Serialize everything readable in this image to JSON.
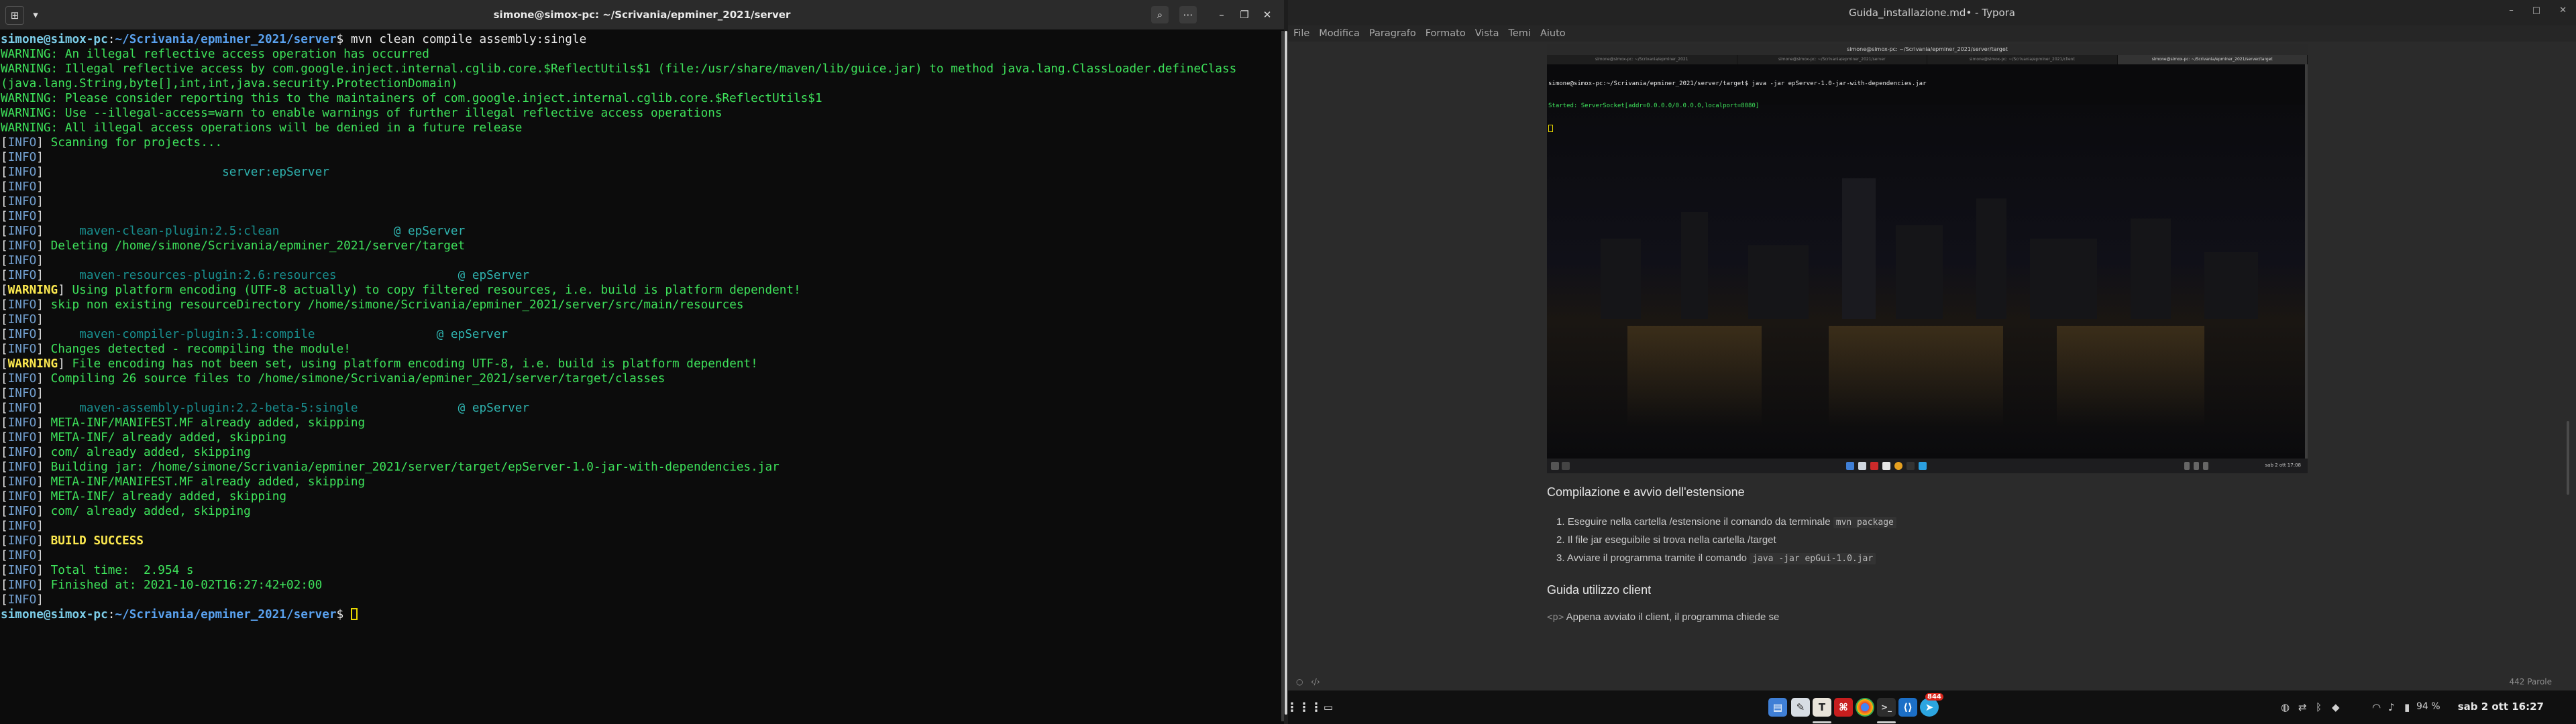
{
  "terminal": {
    "title": "simone@simox-pc: ~/Scrivania/epminer_2021/server",
    "lines": [
      [
        {
          "c": "c-p",
          "t": "simone@simox-pc"
        },
        {
          "c": "c-w",
          "t": ":"
        },
        {
          "c": "c-u",
          "t": "~/Scrivania/epminer_2021/server"
        },
        {
          "c": "c-w",
          "t": "$ mvn clean compile assembly:single"
        }
      ],
      [
        {
          "c": "c-g",
          "t": "WARNING: An illegal reflective access operation has occurred"
        }
      ],
      [
        {
          "c": "c-g",
          "t": "WARNING: Illegal reflective access by com.google.inject.internal.cglib.core.$ReflectUtils$1 (file:/usr/share/maven/lib/guice.jar) to method java.lang.ClassLoader.defineClass"
        }
      ],
      [
        {
          "c": "c-g",
          "t": "(java.lang.String,byte[],int,int,java.security.ProtectionDomain)"
        }
      ],
      [
        {
          "c": "c-g",
          "t": "WARNING: Please consider reporting this to the maintainers of com.google.inject.internal.cglib.core.$ReflectUtils$1"
        }
      ],
      [
        {
          "c": "c-g",
          "t": "WARNING: Use --illegal-access=warn to enable warnings of further illegal reflective access operations"
        }
      ],
      [
        {
          "c": "c-g",
          "t": "WARNING: All illegal access operations will be denied in a future release"
        }
      ],
      [
        {
          "c": "c-w",
          "t": "["
        },
        {
          "c": "c-b",
          "t": "INFO"
        },
        {
          "c": "c-w",
          "t": "] "
        },
        {
          "c": "c-g",
          "t": "Scanning for projects..."
        }
      ],
      [
        {
          "c": "c-w",
          "t": "["
        },
        {
          "c": "c-b",
          "t": "INFO"
        },
        {
          "c": "c-w",
          "t": "]"
        }
      ],
      [
        {
          "c": "c-w",
          "t": "["
        },
        {
          "c": "c-b",
          "t": "INFO"
        },
        {
          "c": "c-w",
          "t": "]                         "
        },
        {
          "c": "c-d",
          "t": "server:epServer"
        }
      ],
      [
        {
          "c": "c-w",
          "t": "["
        },
        {
          "c": "c-b",
          "t": "INFO"
        },
        {
          "c": "c-w",
          "t": "]"
        }
      ],
      [
        {
          "c": "c-w",
          "t": "["
        },
        {
          "c": "c-b",
          "t": "INFO"
        },
        {
          "c": "c-w",
          "t": "]"
        }
      ],
      [
        {
          "c": "c-w",
          "t": "["
        },
        {
          "c": "c-b",
          "t": "INFO"
        },
        {
          "c": "c-w",
          "t": "]"
        }
      ],
      [
        {
          "c": "c-w",
          "t": "["
        },
        {
          "c": "c-b",
          "t": "INFO"
        },
        {
          "c": "c-w",
          "t": "]     "
        },
        {
          "c": "c-t",
          "t": "maven-clean-plugin:2.5:clean"
        },
        {
          "c": "c-w",
          "t": "                "
        },
        {
          "c": "c-d",
          "t": "@ epServer"
        }
      ],
      [
        {
          "c": "c-w",
          "t": "["
        },
        {
          "c": "c-b",
          "t": "INFO"
        },
        {
          "c": "c-w",
          "t": "] "
        },
        {
          "c": "c-g",
          "t": "Deleting /home/simone/Scrivania/epminer_2021/server/target"
        }
      ],
      [
        {
          "c": "c-w",
          "t": "["
        },
        {
          "c": "c-b",
          "t": "INFO"
        },
        {
          "c": "c-w",
          "t": "]"
        }
      ],
      [
        {
          "c": "c-w",
          "t": "["
        },
        {
          "c": "c-b",
          "t": "INFO"
        },
        {
          "c": "c-w",
          "t": "]     "
        },
        {
          "c": "c-t",
          "t": "maven-resources-plugin:2.6:resources"
        },
        {
          "c": "c-w",
          "t": "                 "
        },
        {
          "c": "c-d",
          "t": "@ epServer"
        }
      ],
      [
        {
          "c": "c-w",
          "t": "["
        },
        {
          "c": "c-y",
          "t": "WARNING"
        },
        {
          "c": "c-w",
          "t": "] "
        },
        {
          "c": "c-g",
          "t": "Using platform encoding (UTF-8 actually) to copy filtered resources, i.e. build is platform dependent!"
        }
      ],
      [
        {
          "c": "c-w",
          "t": "["
        },
        {
          "c": "c-b",
          "t": "INFO"
        },
        {
          "c": "c-w",
          "t": "] "
        },
        {
          "c": "c-g",
          "t": "skip non existing resourceDirectory /home/simone/Scrivania/epminer_2021/server/src/main/resources"
        }
      ],
      [
        {
          "c": "c-w",
          "t": "["
        },
        {
          "c": "c-b",
          "t": "INFO"
        },
        {
          "c": "c-w",
          "t": "]"
        }
      ],
      [
        {
          "c": "c-w",
          "t": "["
        },
        {
          "c": "c-b",
          "t": "INFO"
        },
        {
          "c": "c-w",
          "t": "]     "
        },
        {
          "c": "c-t",
          "t": "maven-compiler-plugin:3.1:compile"
        },
        {
          "c": "c-w",
          "t": "                 "
        },
        {
          "c": "c-d",
          "t": "@ epServer"
        }
      ],
      [
        {
          "c": "c-w",
          "t": "["
        },
        {
          "c": "c-b",
          "t": "INFO"
        },
        {
          "c": "c-w",
          "t": "] "
        },
        {
          "c": "c-g",
          "t": "Changes detected - recompiling the module!"
        }
      ],
      [
        {
          "c": "c-w",
          "t": "["
        },
        {
          "c": "c-y",
          "t": "WARNING"
        },
        {
          "c": "c-w",
          "t": "] "
        },
        {
          "c": "c-g",
          "t": "File encoding has not been set, using platform encoding UTF-8, i.e. build is platform dependent!"
        }
      ],
      [
        {
          "c": "c-w",
          "t": "["
        },
        {
          "c": "c-b",
          "t": "INFO"
        },
        {
          "c": "c-w",
          "t": "] "
        },
        {
          "c": "c-g",
          "t": "Compiling 26 source files to /home/simone/Scrivania/epminer_2021/server/target/classes"
        }
      ],
      [
        {
          "c": "c-w",
          "t": "["
        },
        {
          "c": "c-b",
          "t": "INFO"
        },
        {
          "c": "c-w",
          "t": "]"
        }
      ],
      [
        {
          "c": "c-w",
          "t": "["
        },
        {
          "c": "c-b",
          "t": "INFO"
        },
        {
          "c": "c-w",
          "t": "]     "
        },
        {
          "c": "c-t",
          "t": "maven-assembly-plugin:2.2-beta-5:single"
        },
        {
          "c": "c-w",
          "t": "              "
        },
        {
          "c": "c-d",
          "t": "@ epServer"
        }
      ],
      [
        {
          "c": "c-w",
          "t": "["
        },
        {
          "c": "c-b",
          "t": "INFO"
        },
        {
          "c": "c-w",
          "t": "] "
        },
        {
          "c": "c-g",
          "t": "META-INF/MANIFEST.MF already added, skipping"
        }
      ],
      [
        {
          "c": "c-w",
          "t": "["
        },
        {
          "c": "c-b",
          "t": "INFO"
        },
        {
          "c": "c-w",
          "t": "] "
        },
        {
          "c": "c-g",
          "t": "META-INF/ already added, skipping"
        }
      ],
      [
        {
          "c": "c-w",
          "t": "["
        },
        {
          "c": "c-b",
          "t": "INFO"
        },
        {
          "c": "c-w",
          "t": "] "
        },
        {
          "c": "c-g",
          "t": "com/ already added, skipping"
        }
      ],
      [
        {
          "c": "c-w",
          "t": "["
        },
        {
          "c": "c-b",
          "t": "INFO"
        },
        {
          "c": "c-w",
          "t": "] "
        },
        {
          "c": "c-g",
          "t": "Building jar: /home/simone/Scrivania/epminer_2021/server/target/epServer-1.0-jar-with-dependencies.jar"
        }
      ],
      [
        {
          "c": "c-w",
          "t": "["
        },
        {
          "c": "c-b",
          "t": "INFO"
        },
        {
          "c": "c-w",
          "t": "] "
        },
        {
          "c": "c-g",
          "t": "META-INF/MANIFEST.MF already added, skipping"
        }
      ],
      [
        {
          "c": "c-w",
          "t": "["
        },
        {
          "c": "c-b",
          "t": "INFO"
        },
        {
          "c": "c-w",
          "t": "] "
        },
        {
          "c": "c-g",
          "t": "META-INF/ already added, skipping"
        }
      ],
      [
        {
          "c": "c-w",
          "t": "["
        },
        {
          "c": "c-b",
          "t": "INFO"
        },
        {
          "c": "c-w",
          "t": "] "
        },
        {
          "c": "c-g",
          "t": "com/ already added, skipping"
        }
      ],
      [
        {
          "c": "c-w",
          "t": "["
        },
        {
          "c": "c-b",
          "t": "INFO"
        },
        {
          "c": "c-w",
          "t": "]"
        }
      ],
      [
        {
          "c": "c-w",
          "t": "["
        },
        {
          "c": "c-b",
          "t": "INFO"
        },
        {
          "c": "c-w",
          "t": "] "
        },
        {
          "c": "c-y",
          "t": "BUILD SUCCESS"
        }
      ],
      [
        {
          "c": "c-w",
          "t": "["
        },
        {
          "c": "c-b",
          "t": "INFO"
        },
        {
          "c": "c-w",
          "t": "]"
        }
      ],
      [
        {
          "c": "c-w",
          "t": "["
        },
        {
          "c": "c-b",
          "t": "INFO"
        },
        {
          "c": "c-w",
          "t": "] "
        },
        {
          "c": "c-g",
          "t": "Total time:  2.954 s"
        }
      ],
      [
        {
          "c": "c-w",
          "t": "["
        },
        {
          "c": "c-b",
          "t": "INFO"
        },
        {
          "c": "c-w",
          "t": "] "
        },
        {
          "c": "c-g",
          "t": "Finished at: 2021-10-02T16:27:42+02:00"
        }
      ],
      [
        {
          "c": "c-w",
          "t": "["
        },
        {
          "c": "c-b",
          "t": "INFO"
        },
        {
          "c": "c-w",
          "t": "]"
        }
      ],
      [
        {
          "c": "c-p",
          "t": "simone@simox-pc"
        },
        {
          "c": "c-w",
          "t": ":"
        },
        {
          "c": "c-u",
          "t": "~/Scrivania/epminer_2021/server"
        },
        {
          "c": "c-w",
          "t": "$ "
        }
      ]
    ]
  },
  "typora": {
    "title": "Guida_installazione.md• - Typora",
    "menu": [
      "File",
      "Modifica",
      "Paragrafo",
      "Formato",
      "Vista",
      "Temi",
      "Aiuto"
    ],
    "embedded": {
      "title": "simone@simox-pc: ~/Scrivania/epminer_2021/server/target",
      "tabs": [
        "simone@simox-pc: ~/Scrivania/epminer_2021",
        "simone@simox-pc: ~/Scrivania/epminer_2021/server",
        "simone@simox-pc: ~/Scrivania/epminer_2021/client",
        "simone@simox-pc: ~/Scrivania/epminer_2021/server/target"
      ],
      "line1": "simone@simox-pc:~/Scrivania/epminer_2021/server/target$ java -jar epServer-1.0-jar-with-dependencies.jar",
      "line2": "Started: ServerSocket[addr=0.0.0.0/0.0.0.0,localport=8080]",
      "clock": "sab 2 ott 17:08"
    },
    "heading1": "Compilazione e avvio dell'estensione",
    "list": [
      {
        "num": "1.",
        "text": "Eseguire nella cartella /estensione il comando da terminale",
        "code": "mvn package"
      },
      {
        "num": "2.",
        "text": "Il file jar eseguibile si trova nella cartella /target",
        "code": ""
      },
      {
        "num": "3.",
        "text": "Avviare il programma tramite il comando",
        "code": "java -jar epGui-1.0.jar"
      }
    ],
    "heading2": "Guida utilizzo client",
    "para_tag": "<p>",
    "para_text": "Appena avviato il client, il programma chiede se",
    "word_count": "442 Parole"
  },
  "taskbar": {
    "badge": "844",
    "battery": "94 %",
    "clock": "sab 2 ott  16:27"
  }
}
